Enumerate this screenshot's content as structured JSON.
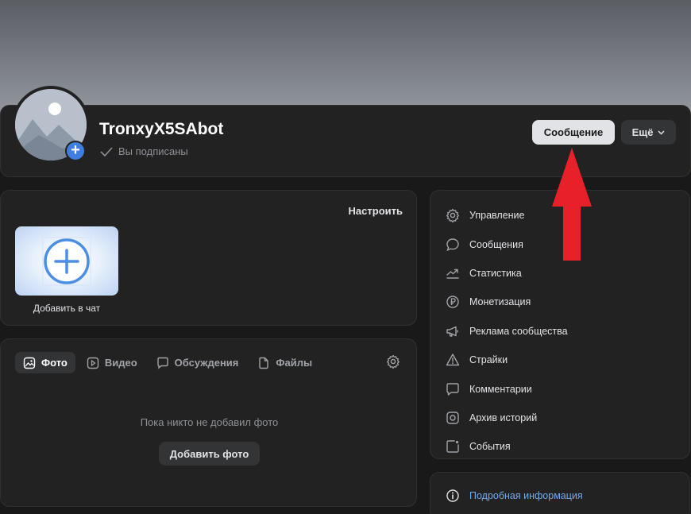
{
  "profile": {
    "name": "TronxyX5SAbot",
    "subscribed_status": "Вы подписаны",
    "message_button": "Сообщение",
    "more_button": "Ещё"
  },
  "chat_widget": {
    "configure_label": "Настроить",
    "add_to_chat_label": "Добавить в чат"
  },
  "media": {
    "tabs": [
      {
        "label": "Фото",
        "icon": "photo-icon",
        "active": true
      },
      {
        "label": "Видео",
        "icon": "video-icon",
        "active": false
      },
      {
        "label": "Обсуждения",
        "icon": "discussion-icon",
        "active": false
      },
      {
        "label": "Файлы",
        "icon": "file-icon",
        "active": false
      }
    ],
    "empty_text": "Пока никто не добавил фото",
    "add_photo_button": "Добавить фото"
  },
  "side_menu": {
    "items": [
      {
        "label": "Управление",
        "icon": "gear-icon"
      },
      {
        "label": "Сообщения",
        "icon": "message-icon"
      },
      {
        "label": "Статистика",
        "icon": "chart-icon"
      },
      {
        "label": "Монетизация",
        "icon": "ruble-icon"
      },
      {
        "label": "Реклама сообщества",
        "icon": "megaphone-icon"
      },
      {
        "label": "Страйки",
        "icon": "warning-icon"
      },
      {
        "label": "Комментарии",
        "icon": "comment-icon"
      },
      {
        "label": "Архив историй",
        "icon": "story-archive-icon"
      },
      {
        "label": "События",
        "icon": "event-icon"
      }
    ]
  },
  "info": {
    "details_link": "Подробная информация"
  },
  "colors": {
    "background": "#19191a",
    "card": "#222222",
    "accent": "#3f7de0",
    "link": "#71aaeb",
    "arrow": "#e8202a"
  }
}
